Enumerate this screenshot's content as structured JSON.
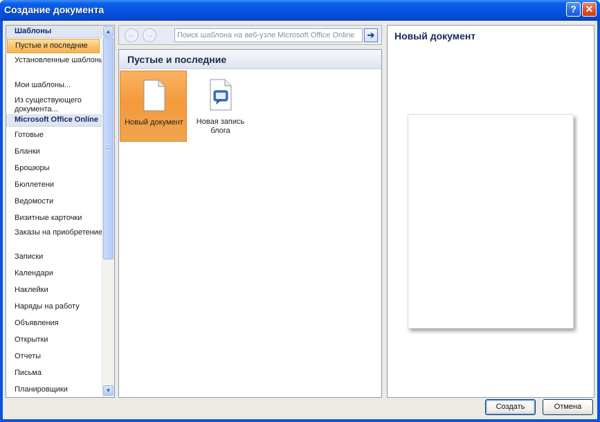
{
  "window": {
    "title": "Создание документа"
  },
  "titlebar": {
    "help_glyph": "?",
    "close_glyph": "✕"
  },
  "left_pane": {
    "templates_header": "Шаблоны",
    "templates_items": [
      {
        "label": "Пустые и последние",
        "selected": true
      },
      {
        "label": "Установленные шаблоны"
      },
      {
        "label": "Мои шаблоны..."
      },
      {
        "label": "Из существующего документа..."
      }
    ],
    "online_header": "Microsoft Office Online",
    "online_items": [
      "Готовые",
      "Бланки",
      "Брошюры",
      "Бюллетени",
      "Ведомости",
      "Визитные карточки",
      "Заказы на приобретение",
      "Записки",
      "Календари",
      "Наклейки",
      "Наряды на работу",
      "Объявления",
      "Открытки",
      "Отчеты",
      "Письма",
      "Планировщики"
    ]
  },
  "toolbar": {
    "back_glyph": "←",
    "forward_glyph": "→",
    "search_placeholder": "Поиск шаблона на веб-узле Microsoft Office Online",
    "go_glyph": "➔"
  },
  "middle": {
    "header": "Пустые и последние",
    "tiles": [
      {
        "label": "Новый документ",
        "icon": "blank-document-icon",
        "selected": true
      },
      {
        "label": "Новая запись блога",
        "icon": "blog-post-icon"
      }
    ]
  },
  "right": {
    "preview_title": "Новый документ"
  },
  "buttons": {
    "create": "Создать",
    "cancel": "Отмена"
  },
  "colors": {
    "accent_selected": "#f6b350",
    "title_bar": "#0654e0",
    "header_text": "#15286e"
  }
}
